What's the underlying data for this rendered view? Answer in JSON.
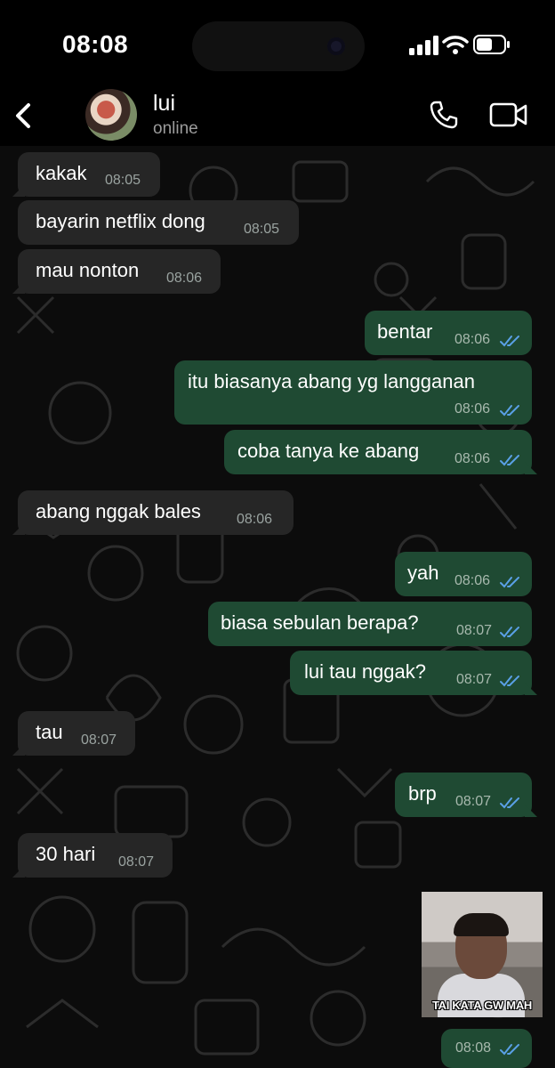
{
  "status_bar": {
    "time": "08:08"
  },
  "contact": {
    "name": "lui",
    "status": "online"
  },
  "messages": [
    {
      "dir": "in",
      "text": "kakak",
      "time": "08:05"
    },
    {
      "dir": "in",
      "text": "bayarin netflix dong",
      "time": "08:05"
    },
    {
      "dir": "in",
      "text": "mau nonton",
      "time": "08:06"
    },
    {
      "dir": "out",
      "text": "bentar",
      "time": "08:06",
      "status": "read"
    },
    {
      "dir": "out",
      "text": "itu biasanya abang yg langganan",
      "time": "08:06",
      "status": "read"
    },
    {
      "dir": "out",
      "text": "coba tanya ke abang",
      "time": "08:06",
      "status": "read"
    },
    {
      "dir": "in",
      "text": "abang nggak bales",
      "time": "08:06"
    },
    {
      "dir": "out",
      "text": "yah",
      "time": "08:06",
      "status": "read"
    },
    {
      "dir": "out",
      "text": "biasa sebulan berapa?",
      "time": "08:07",
      "status": "read"
    },
    {
      "dir": "out",
      "text": "lui tau nggak?",
      "time": "08:07",
      "status": "read"
    },
    {
      "dir": "in",
      "text": "tau",
      "time": "08:07"
    },
    {
      "dir": "out",
      "text": "brp",
      "time": "08:07",
      "status": "read"
    },
    {
      "dir": "in",
      "text": "30 hari",
      "time": "08:07"
    },
    {
      "dir": "out",
      "type": "sticker",
      "caption": "TAI KATA GW MAH"
    },
    {
      "dir": "out",
      "text": "",
      "time": "08:08",
      "status": "read"
    }
  ],
  "colors": {
    "incoming_bubble": "#262626",
    "outgoing_bubble": "#1f4a33",
    "read_ticks": "#5aa0e6",
    "chat_background": "#0c0c0c"
  },
  "icons": [
    "back-chevron-icon",
    "phone-icon",
    "video-camera-icon",
    "signal-icon",
    "wifi-icon",
    "battery-icon",
    "double-check-icon"
  ]
}
